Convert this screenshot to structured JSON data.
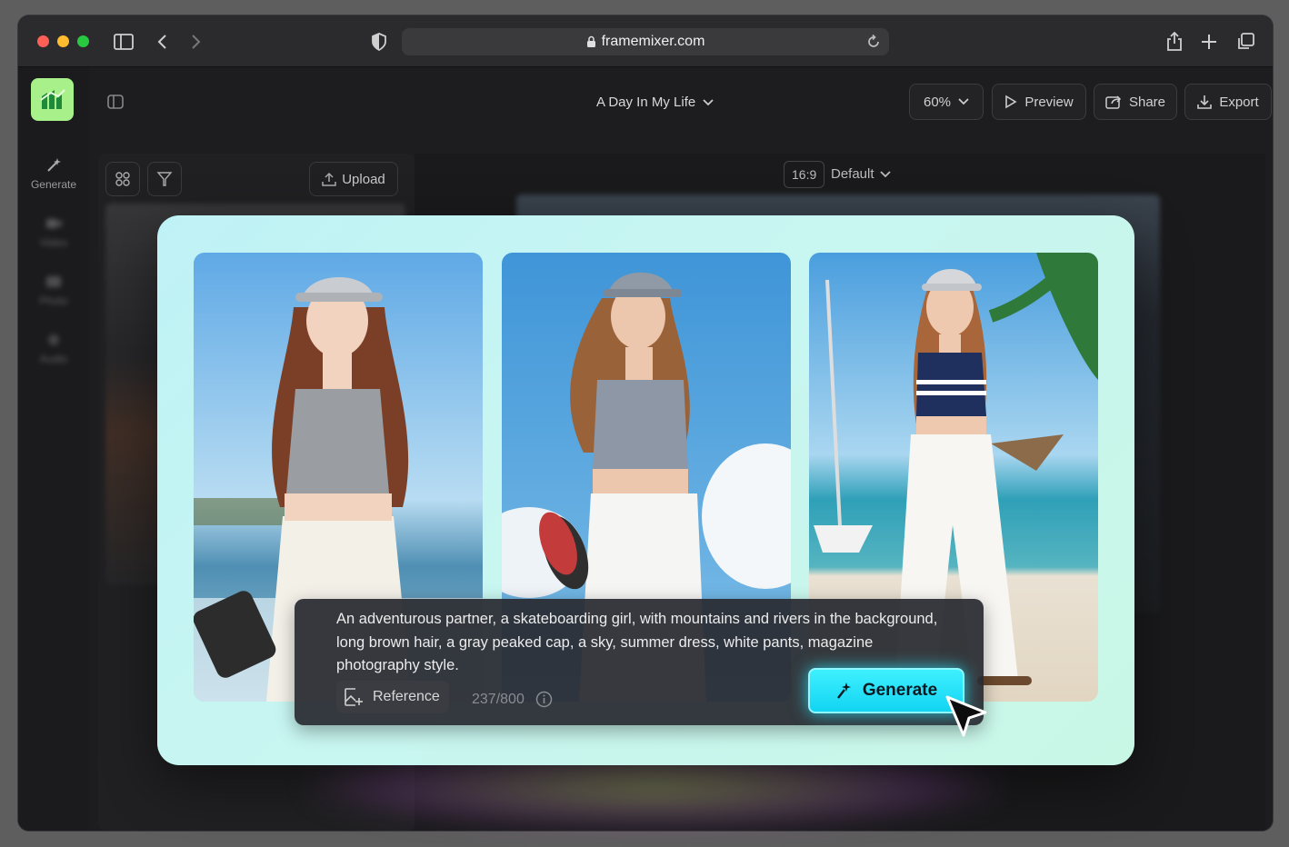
{
  "browser": {
    "url": "framemixer.com"
  },
  "sidebar": {
    "items": [
      {
        "label": "Generate"
      },
      {
        "label": "Video"
      },
      {
        "label": "Photo"
      },
      {
        "label": "Audio"
      }
    ]
  },
  "topbar": {
    "project_title": "A Day In My Life",
    "zoom": "60%",
    "preview_label": "Preview",
    "share_label": "Share",
    "export_label": "Export"
  },
  "media_panel": {
    "upload_label": "Upload"
  },
  "canvas": {
    "aspect_ratio": "16:9",
    "layout": "Default"
  },
  "prompt": {
    "text": "An adventurous partner, a skateboarding girl, with mountains and rivers in the background, long brown hair, a gray peaked cap, a sky, summer dress, white pants, magazine photography style.",
    "reference_label": "Reference",
    "char_count": "237/800",
    "generate_label": "Generate"
  },
  "colors": {
    "card_bg": "#c8f6f1",
    "generate_accent": "#12d4f2",
    "logo_green": "#a8f08a"
  }
}
